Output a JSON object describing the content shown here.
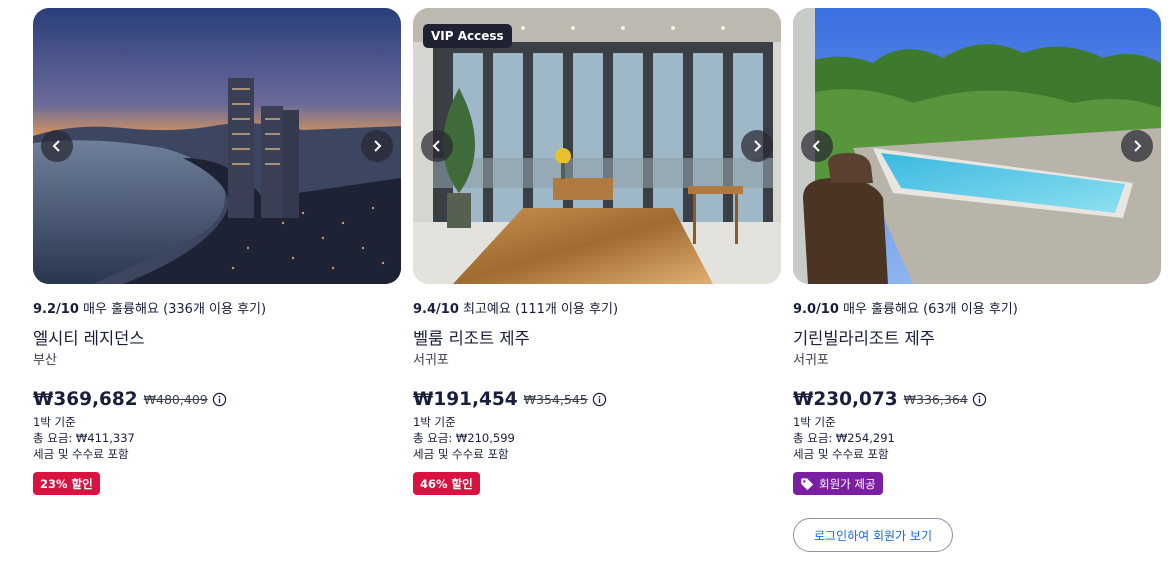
{
  "cards": [
    {
      "score": "9.2/10",
      "rating_text": "매우 훌륭해요",
      "reviews": "(336개 이용 후기)",
      "name": "엘시티 레지던스",
      "city": "부산",
      "price": "₩369,682",
      "old_price": "₩480,409",
      "per_night": "1박 기준",
      "total": "총 요금: ₩411,337",
      "taxes": "세금 및 수수료 포함",
      "badge": "23% 할인",
      "prev_icon": "chevron-left-icon",
      "next_icon": "chevron-right-icon"
    },
    {
      "vip": "VIP Access",
      "score": "9.4/10",
      "rating_text": "최고예요",
      "reviews": "(111개 이용 후기)",
      "name": "벨룸 리조트 제주",
      "city": "서귀포",
      "price": "₩191,454",
      "old_price": "₩354,545",
      "per_night": "1박 기준",
      "total": "총 요금: ₩210,599",
      "taxes": "세금 및 수수료 포함",
      "badge": "46% 할인",
      "prev_icon": "chevron-left-icon",
      "next_icon": "chevron-right-icon"
    },
    {
      "score": "9.0/10",
      "rating_text": "매우 훌륭해요",
      "reviews": "(63개 이용 후기)",
      "name": "기린빌라리조트 제주",
      "city": "서귀포",
      "price": "₩230,073",
      "old_price": "₩336,364",
      "per_night": "1박 기준",
      "total": "총 요금: ₩254,291",
      "taxes": "세금 및 수수료 포함",
      "badge": "회원가 제공",
      "badge_icon": "tag-icon",
      "login_button": "로그인하여 회원가 보기",
      "prev_icon": "chevron-left-icon",
      "next_icon": "chevron-right-icon"
    }
  ],
  "colors": {
    "text": "#191e3b",
    "discount_badge": "#d9123f",
    "member_badge": "#7b1fa2",
    "link": "#1668e3",
    "vip_badge": "#1e2233"
  }
}
